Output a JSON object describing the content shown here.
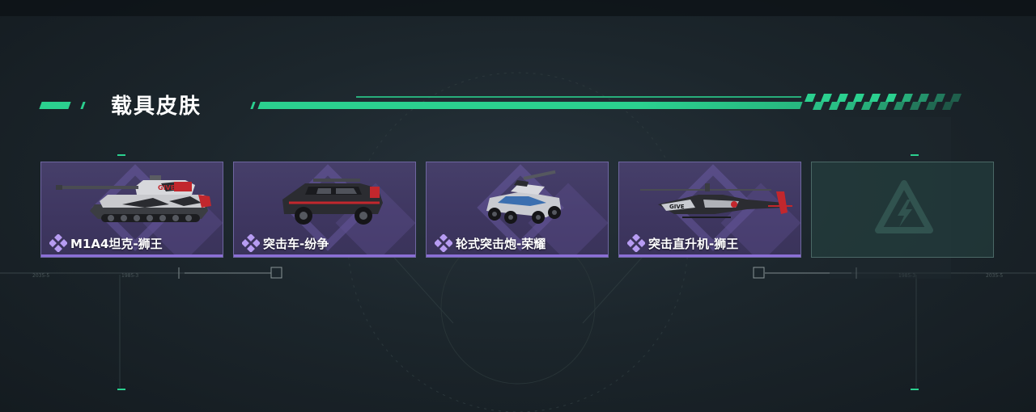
{
  "section": {
    "title": "载具皮肤"
  },
  "skins": [
    {
      "name": "M1A4坦克-狮王",
      "vehicle_icon": "tank-icon"
    },
    {
      "name": "突击车-纷争",
      "vehicle_icon": "assault-car-icon"
    },
    {
      "name": "轮式突击炮-荣耀",
      "vehicle_icon": "wheeled-assault-gun-icon"
    },
    {
      "name": "突击直升机-狮王",
      "vehicle_icon": "attack-helicopter-icon"
    }
  ],
  "empty_slot": {
    "icon": "game-logo-icon"
  },
  "colors": {
    "accent": "#2bd08f",
    "card_purple": "#463f6a",
    "card_underline": "#8b6fd6",
    "rarity_icon": "#b79cf2"
  }
}
